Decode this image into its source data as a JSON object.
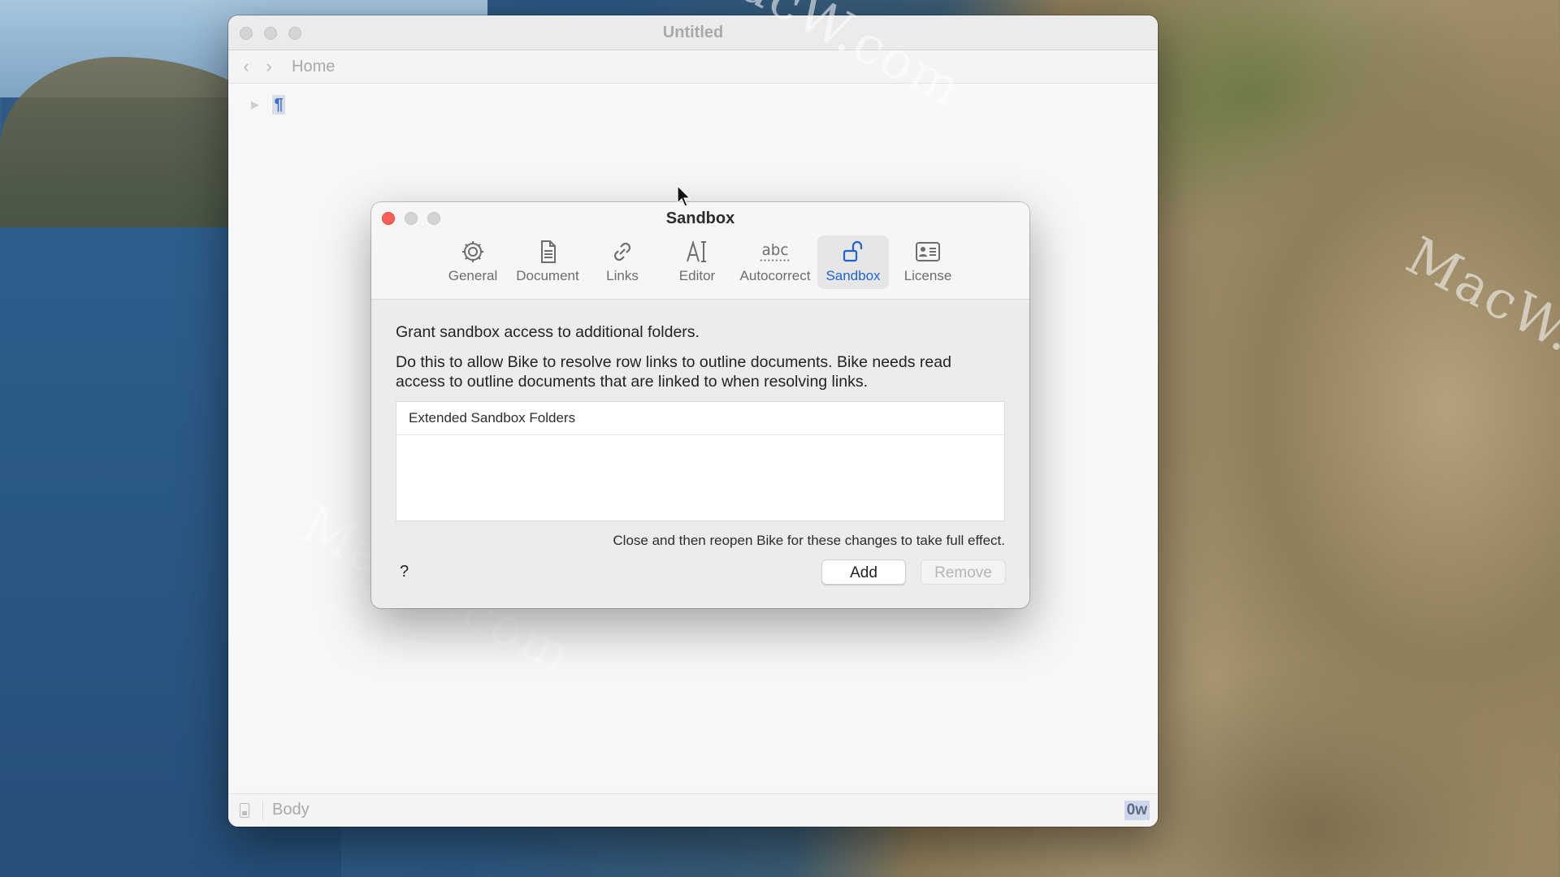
{
  "main_window": {
    "title": "Untitled",
    "breadcrumb": "Home",
    "editor": {
      "row_text": "¶"
    },
    "status": {
      "style": "Body",
      "word_count": "0w"
    }
  },
  "dialog": {
    "title": "Sandbox",
    "tabs": [
      {
        "label": "General",
        "icon": "gear-icon",
        "active": false
      },
      {
        "label": "Document",
        "icon": "document-icon",
        "active": false
      },
      {
        "label": "Links",
        "icon": "link-icon",
        "active": false
      },
      {
        "label": "Editor",
        "icon": "text-cursor-icon",
        "active": false
      },
      {
        "label": "Autocorrect",
        "icon": "abc-icon",
        "active": false
      },
      {
        "label": "Sandbox",
        "icon": "unlock-icon",
        "active": true
      },
      {
        "label": "License",
        "icon": "id-card-icon",
        "active": false
      }
    ],
    "heading": "Grant sandbox access to additional folders.",
    "description": "Do this to allow Bike to resolve row links to outline documents. Bike needs read access to outline documents that are linked to when resolving links.",
    "table_header": "Extended Sandbox Folders",
    "table_rows": [],
    "note": "Close and then reopen Bike for these changes to take full effect.",
    "help_label": "?",
    "add_label": "Add",
    "remove_label": "Remove"
  },
  "watermark": "MacW.com",
  "colors": {
    "accent": "#1f63d3",
    "close_button": "#fe5f57"
  }
}
